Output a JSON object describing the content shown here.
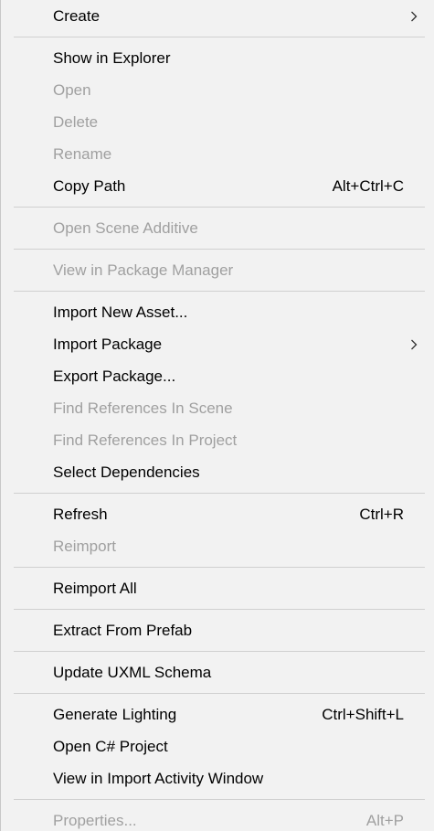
{
  "menu": {
    "items": [
      {
        "label": "Create",
        "shortcut": "",
        "disabled": false,
        "submenu": true
      },
      {
        "separator": true
      },
      {
        "label": "Show in Explorer",
        "shortcut": "",
        "disabled": false
      },
      {
        "label": "Open",
        "shortcut": "",
        "disabled": true
      },
      {
        "label": "Delete",
        "shortcut": "",
        "disabled": true
      },
      {
        "label": "Rename",
        "shortcut": "",
        "disabled": true
      },
      {
        "label": "Copy Path",
        "shortcut": "Alt+Ctrl+C",
        "disabled": false
      },
      {
        "separator": true
      },
      {
        "label": "Open Scene Additive",
        "shortcut": "",
        "disabled": true
      },
      {
        "separator": true
      },
      {
        "label": "View in Package Manager",
        "shortcut": "",
        "disabled": true
      },
      {
        "separator": true
      },
      {
        "label": "Import New Asset...",
        "shortcut": "",
        "disabled": false
      },
      {
        "label": "Import Package",
        "shortcut": "",
        "disabled": false,
        "submenu": true
      },
      {
        "label": "Export Package...",
        "shortcut": "",
        "disabled": false
      },
      {
        "label": "Find References In Scene",
        "shortcut": "",
        "disabled": true
      },
      {
        "label": "Find References In Project",
        "shortcut": "",
        "disabled": true
      },
      {
        "label": "Select Dependencies",
        "shortcut": "",
        "disabled": false
      },
      {
        "separator": true
      },
      {
        "label": "Refresh",
        "shortcut": "Ctrl+R",
        "disabled": false
      },
      {
        "label": "Reimport",
        "shortcut": "",
        "disabled": true
      },
      {
        "separator": true
      },
      {
        "label": "Reimport All",
        "shortcut": "",
        "disabled": false
      },
      {
        "separator": true
      },
      {
        "label": "Extract From Prefab",
        "shortcut": "",
        "disabled": false
      },
      {
        "separator": true
      },
      {
        "label": "Update UXML Schema",
        "shortcut": "",
        "disabled": false
      },
      {
        "separator": true
      },
      {
        "label": "Generate Lighting",
        "shortcut": "Ctrl+Shift+L",
        "disabled": false
      },
      {
        "label": "Open C# Project",
        "shortcut": "",
        "disabled": false
      },
      {
        "label": "View in Import Activity Window",
        "shortcut": "",
        "disabled": false
      },
      {
        "separator": true
      },
      {
        "label": "Properties...",
        "shortcut": "Alt+P",
        "disabled": true
      }
    ]
  },
  "colors": {
    "background": "#f2f2f2",
    "text": "#000000",
    "disabled_text": "#a0a0a0",
    "separator": "#d0d0d0"
  },
  "icons": {
    "submenu": "chevron-right-icon"
  }
}
